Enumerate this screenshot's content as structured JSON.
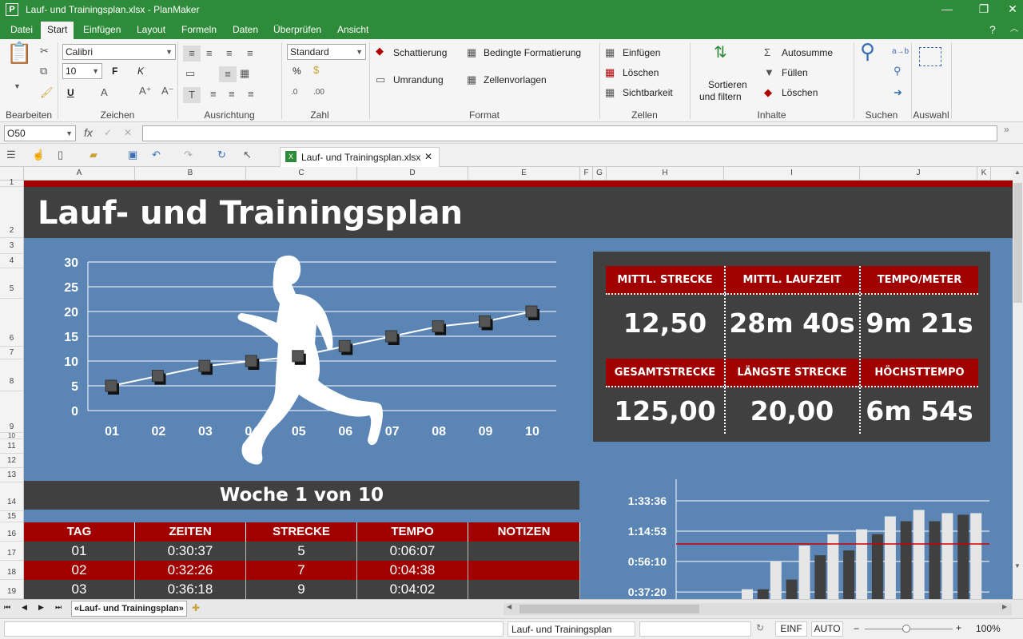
{
  "window": {
    "title": "Lauf- und Trainingsplan.xlsx - PlanMaker",
    "app_icon": "P",
    "help": "?"
  },
  "menu": {
    "tabs": [
      "Datei",
      "Start",
      "Einfügen",
      "Layout",
      "Formeln",
      "Daten",
      "Überprüfen",
      "Ansicht"
    ],
    "active": "Start"
  },
  "ribbon": {
    "groups": [
      "Bearbeiten",
      "Zeichen",
      "Ausrichtung",
      "Zahl",
      "Format",
      "Zellen",
      "Inhalte",
      "Suchen",
      "Auswahl"
    ],
    "font_name": "Calibri",
    "font_size": "10",
    "bold": "F",
    "italic": "K",
    "underline": "U",
    "number_format": "Standard",
    "percent": "%",
    "format": {
      "shading": "Schattierung",
      "conditional": "Bedingte Formatierung",
      "border": "Umrandung",
      "cell_styles": "Zellenvorlagen"
    },
    "cells": {
      "insert": "Einfügen",
      "delete": "Löschen",
      "visibility": "Sichtbarkeit"
    },
    "content": {
      "sort_l1": "Sortieren",
      "sort_l2": "und filtern",
      "autosum": "Autosumme",
      "fill": "Füllen",
      "delete": "Löschen"
    },
    "search_replace": "a→b"
  },
  "formula_bar": {
    "cell_ref": "O50",
    "fx": "fx",
    "value": ""
  },
  "doc_tab": {
    "name": "Lauf- und Trainingsplan.xlsx"
  },
  "columns": [
    "A",
    "B",
    "C",
    "D",
    "E",
    "F",
    "G",
    "H",
    "I",
    "J",
    "K"
  ],
  "rows": [
    "1",
    "2",
    "3",
    "4",
    "5",
    "6",
    "7",
    "8",
    "9",
    "10",
    "11",
    "12",
    "13",
    "14",
    "15",
    "16",
    "17",
    "18",
    "19"
  ],
  "sheet": {
    "title": "Lauf- und Trainingsplan",
    "week": "Woche 1 von 10",
    "stats": [
      {
        "label": "MITTL. STRECKE",
        "value": "12,50"
      },
      {
        "label": "MITTL. LAUFZEIT",
        "value": "28m 40s"
      },
      {
        "label": "TEMPO/METER",
        "value": "9m 21s"
      },
      {
        "label": "GESAMTSTRECKE",
        "value": "125,00"
      },
      {
        "label": "LÄNGSTE STRECKE",
        "value": "20,00"
      },
      {
        "label": "HÖCHSTTEMPO",
        "value": "6m 54s"
      }
    ],
    "table": {
      "headers": [
        "TAG",
        "ZEITEN",
        "STRECKE",
        "TEMPO",
        "NOTIZEN"
      ],
      "rows": [
        [
          "01",
          "0:30:37",
          "5",
          "0:06:07",
          ""
        ],
        [
          "02",
          "0:32:26",
          "7",
          "0:04:38",
          ""
        ],
        [
          "03",
          "0:36:18",
          "9",
          "0:04:02",
          ""
        ]
      ]
    }
  },
  "chart_data": [
    {
      "type": "line",
      "x": [
        "01",
        "02",
        "03",
        "04",
        "05",
        "06",
        "07",
        "08",
        "09",
        "10"
      ],
      "series": [
        {
          "values": [
            5,
            7,
            9,
            10,
            11,
            13,
            15,
            17,
            18,
            20
          ]
        }
      ],
      "ylim": [
        0,
        30
      ],
      "yticks": [
        0,
        5,
        10,
        15,
        20,
        25,
        30
      ],
      "grid": true,
      "title": "",
      "xlabel": "",
      "ylabel": ""
    },
    {
      "type": "bar",
      "yticks_labels": [
        "0:37:20",
        "0:56:10",
        "1:14:53",
        "1:33:36"
      ],
      "yticks_values_min": [
        37.33,
        56.17,
        74.88,
        93.6
      ],
      "ylim_min": [
        30,
        102
      ],
      "visible_tick_labels": [
        "1:33:36",
        "1:14:53",
        "0:56:10"
      ],
      "series": [
        {
          "color": "#404040",
          "values_min": [
            31,
            39,
            45,
            60,
            63,
            73,
            81,
            81,
            85
          ]
        },
        {
          "color": "#e6e6e6",
          "values_min": [
            39,
            56,
            66,
            73,
            76,
            84,
            88,
            86,
            86
          ]
        }
      ],
      "reference_line_min": 67,
      "reference_color": "#cc0000",
      "grid": true
    }
  ],
  "sheet_tabs": {
    "active": "«Lauf- und Trainingsplan»"
  },
  "status": {
    "sheet": "Lauf- und Trainingsplan",
    "mode1": "EINF",
    "mode2": "AUTO",
    "zoom": "100%"
  },
  "colors": {
    "green": "#2e8b3a",
    "red": "#a00000",
    "blue": "#5b85b4",
    "dark": "#404040"
  }
}
